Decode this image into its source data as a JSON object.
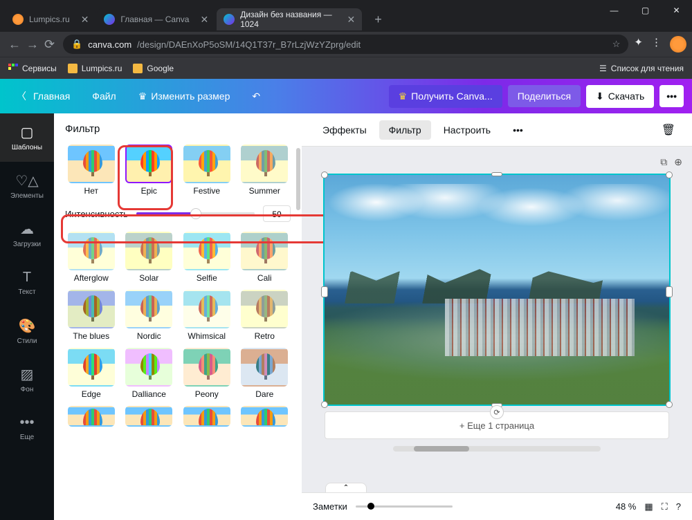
{
  "browser": {
    "tabs": [
      {
        "title": "Lumpics.ru",
        "favicon": "orange"
      },
      {
        "title": "Главная — Canva",
        "favicon": "canva"
      },
      {
        "title": "Дизайн без названия — 1024",
        "favicon": "canva",
        "active": true
      }
    ],
    "url_domain": "canva.com",
    "url_path": "/design/DAEnXoP5oSM/14Q1T37r_B7rLzjWzYZprg/edit",
    "bookmarks": {
      "services": "Сервисы",
      "lumpics": "Lumpics.ru",
      "google": "Google",
      "reading_list": "Список для чтения"
    }
  },
  "header": {
    "home": "Главная",
    "file": "Файл",
    "resize": "Изменить размер",
    "get_pro": "Получить Canva...",
    "share": "Поделиться",
    "download": "Скачать"
  },
  "sidebar": {
    "templates": "Шаблоны",
    "elements": "Элементы",
    "uploads": "Загрузки",
    "text": "Текст",
    "styles": "Стили",
    "background": "Фон",
    "more": "Еще"
  },
  "panel": {
    "title": "Фильтр",
    "intensity_label": "Интенсивность",
    "intensity_value": "50",
    "filters_row1": [
      "Нет",
      "Epic",
      "Festive",
      "Summer"
    ],
    "filters_row2": [
      "Afterglow",
      "Solar",
      "Selfie",
      "Cali"
    ],
    "filters_row3": [
      "The blues",
      "Nordic",
      "Whimsical",
      "Retro"
    ],
    "filters_row4": [
      "Edge",
      "Dalliance",
      "Peony",
      "Dare"
    ],
    "selected_filter": "Epic"
  },
  "canvas": {
    "toolbar": {
      "effects": "Эффекты",
      "filter": "Фильтр",
      "adjust": "Настроить"
    },
    "add_page": "+ Еще 1 страница"
  },
  "bottombar": {
    "notes": "Заметки",
    "zoom": "48 %"
  }
}
